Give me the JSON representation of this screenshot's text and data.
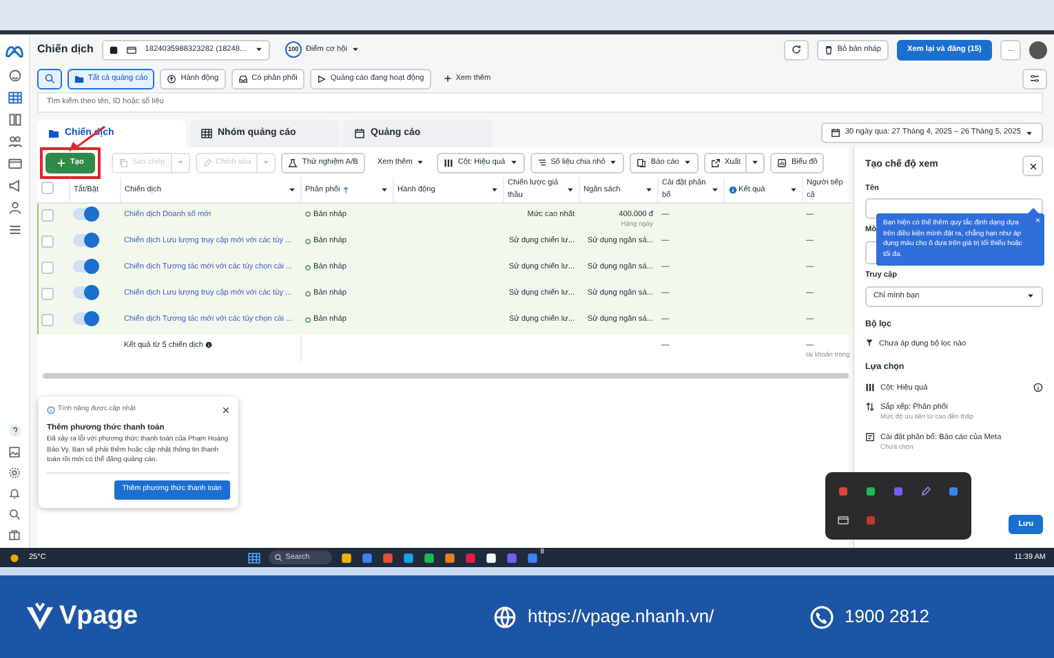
{
  "header": {
    "title": "Chiến dịch",
    "account": "1824035988323282 (18248...",
    "score": "100",
    "score_label": "Điểm cơ hội",
    "discard": "Bỏ bản nháp",
    "review": "Xem lại và đăng (15)",
    "more": "..."
  },
  "filters": [
    {
      "label": "Tất cả quảng cáo",
      "selected": true
    },
    {
      "label": "Hành động",
      "selected": false
    },
    {
      "label": "Có phân phối",
      "selected": false
    },
    {
      "label": "Quảng cáo đang hoạt động",
      "selected": false
    }
  ],
  "more_filters": "Xem thêm",
  "search": {
    "placeholder": "Tìm kiếm theo tên, ID hoặc số liệu"
  },
  "tabs": [
    {
      "label": "Chiến dịch",
      "selected": true
    },
    {
      "label": "Nhóm quảng cáo",
      "selected": false
    },
    {
      "label": "Quảng cáo",
      "selected": false
    }
  ],
  "date_range": "30 ngày qua: 27 Tháng 4, 2025 – 26 Tháng 5, 2025",
  "toolbar": [
    {
      "kind": "primary",
      "label": "Tạo",
      "disabled": false,
      "highlighted": true
    },
    {
      "kind": "split",
      "label": "Sao chép",
      "disabled": true,
      "highlighted": false
    },
    {
      "kind": "split",
      "label": "Chỉnh sửa",
      "disabled": true,
      "highlighted": false
    },
    {
      "kind": "button",
      "label": "Thử nghiệm A/B",
      "disabled": false,
      "highlighted": false
    },
    {
      "kind": "plain-menu",
      "label": "Xem thêm",
      "disabled": false,
      "highlighted": false
    },
    {
      "kind": "menu",
      "label": "Cột: Hiệu quả",
      "disabled": false,
      "highlighted": false
    },
    {
      "kind": "menu",
      "label": "Số liệu chia nhỏ",
      "disabled": false,
      "highlighted": false
    },
    {
      "kind": "menu",
      "label": "Báo cáo",
      "disabled": false,
      "highlighted": false
    },
    {
      "kind": "split",
      "label": "Xuất",
      "disabled": false,
      "highlighted": false
    },
    {
      "kind": "button",
      "label": "Biểu đồ",
      "disabled": false,
      "highlighted": false
    }
  ],
  "table": {
    "all_checked": false,
    "columns": [
      {
        "label": "Tắt/Bật",
        "menu": false,
        "sorted": false,
        "info": false
      },
      {
        "label": "Chiến dịch",
        "menu": true,
        "sorted": false,
        "info": false
      },
      {
        "label": "Phân phối",
        "menu": true,
        "sorted": true,
        "info": false
      },
      {
        "label": "Hành động",
        "menu": true,
        "sorted": false,
        "info": false
      },
      {
        "label": "Chiến lược giá thầu",
        "menu": true,
        "sorted": false,
        "info": false
      },
      {
        "label": "Ngân sách",
        "menu": true,
        "sorted": false,
        "info": false
      },
      {
        "label": "Cài đặt phân bổ",
        "menu": true,
        "sorted": false,
        "info": false
      },
      {
        "label": "Kết quả",
        "menu": true,
        "sorted": false,
        "info": true
      },
      {
        "label": "Người tiếp cậ",
        "menu": false,
        "sorted": false,
        "info": false
      }
    ],
    "rows": [
      {
        "checked": false,
        "on": true,
        "name": "Chiến dịch Doanh số mới",
        "delivery": "Bản nháp",
        "bid_strategy": "Mức cao nhất",
        "budget": "400.000 đ",
        "budget_note": "Hàng ngày",
        "attribution": "—",
        "reach": "—"
      },
      {
        "checked": false,
        "on": true,
        "name": "Chiến dịch Lưu lượng truy cập mới với các tùy ...",
        "delivery": "Bản nháp",
        "bid_strategy": "Sử dụng chiến lư...",
        "budget": "Sử dụng ngân sá...",
        "attribution": "—",
        "reach": "—"
      },
      {
        "checked": false,
        "on": true,
        "name": "Chiến dịch Tương tác mới với các tùy chọn cài ...",
        "delivery": "Bản nháp",
        "bid_strategy": "Sử dụng chiến lư...",
        "budget": "Sử dụng ngân sá...",
        "attribution": "—",
        "reach": "—"
      },
      {
        "checked": false,
        "on": true,
        "name": "Chiến dịch Lưu lượng truy cập mới với các tùy ...",
        "delivery": "Bản nháp",
        "bid_strategy": "Sử dụng chiến lư...",
        "budget": "Sử dụng ngân sá...",
        "attribution": "—",
        "reach": "—"
      },
      {
        "checked": false,
        "on": true,
        "name": "Chiến dịch Tương tác mới với các tùy chọn cài ...",
        "delivery": "Bản nháp",
        "bid_strategy": "Sử dụng chiến lư...",
        "budget": "Sử dụng ngân sá...",
        "attribution": "—",
        "reach": "—"
      }
    ],
    "footer": {
      "label": "Kết quả từ 5 chiến dịch",
      "attribution": "—",
      "reach": "—",
      "note": "tài khoản trong"
    }
  },
  "notice": {
    "tag": "Tính năng được cập nhật",
    "title": "Thêm phương thức thanh toán",
    "body": "Đã xảy ra lỗi với phương thức thanh toán của Phạm Hoàng Bảo Vy. Bạn sẽ phải thêm hoặc cập nhật thông tin thanh toán rồi mới có thể đăng quảng cáo.",
    "button": "Thêm phương thức thanh toán"
  },
  "view_panel": {
    "title": "Tạo chế độ xem",
    "name_label": "Tên",
    "desc_label": "Mô",
    "tooltip_close": "×",
    "tooltip": "Bạn hiện có thể thêm quy tắc định dạng dựa trên điều kiện mình đặt ra, chẳng hạn như áp dụng màu cho ô dựa trên giá trị tối thiểu hoặc tối đa.",
    "access_label": "Truy cập",
    "access_value": "Chỉ mình bạn",
    "filter_heading": "Bộ lọc",
    "filter_text": "Chưa áp dụng bộ lọc nào",
    "options_heading": "Lựa chọn",
    "options": [
      {
        "title": "Cột: Hiệu quả"
      },
      {
        "title": "Sắp xếp: Phân phối",
        "subtitle": "Mức độ ưu tiên từ cao đến thấp"
      },
      {
        "title": "Cài đặt phân bổ: Báo cáo của Meta",
        "subtitle": "Chưa chọn"
      }
    ],
    "save": "Lưu"
  },
  "taskbar": {
    "weather": "25°C",
    "search": "Search",
    "badge": "8",
    "time": "11:39 AM"
  },
  "banner": {
    "brand": "Vpage",
    "url": "https://vpage.nhanh.vn/",
    "phone": "1900 2812"
  }
}
